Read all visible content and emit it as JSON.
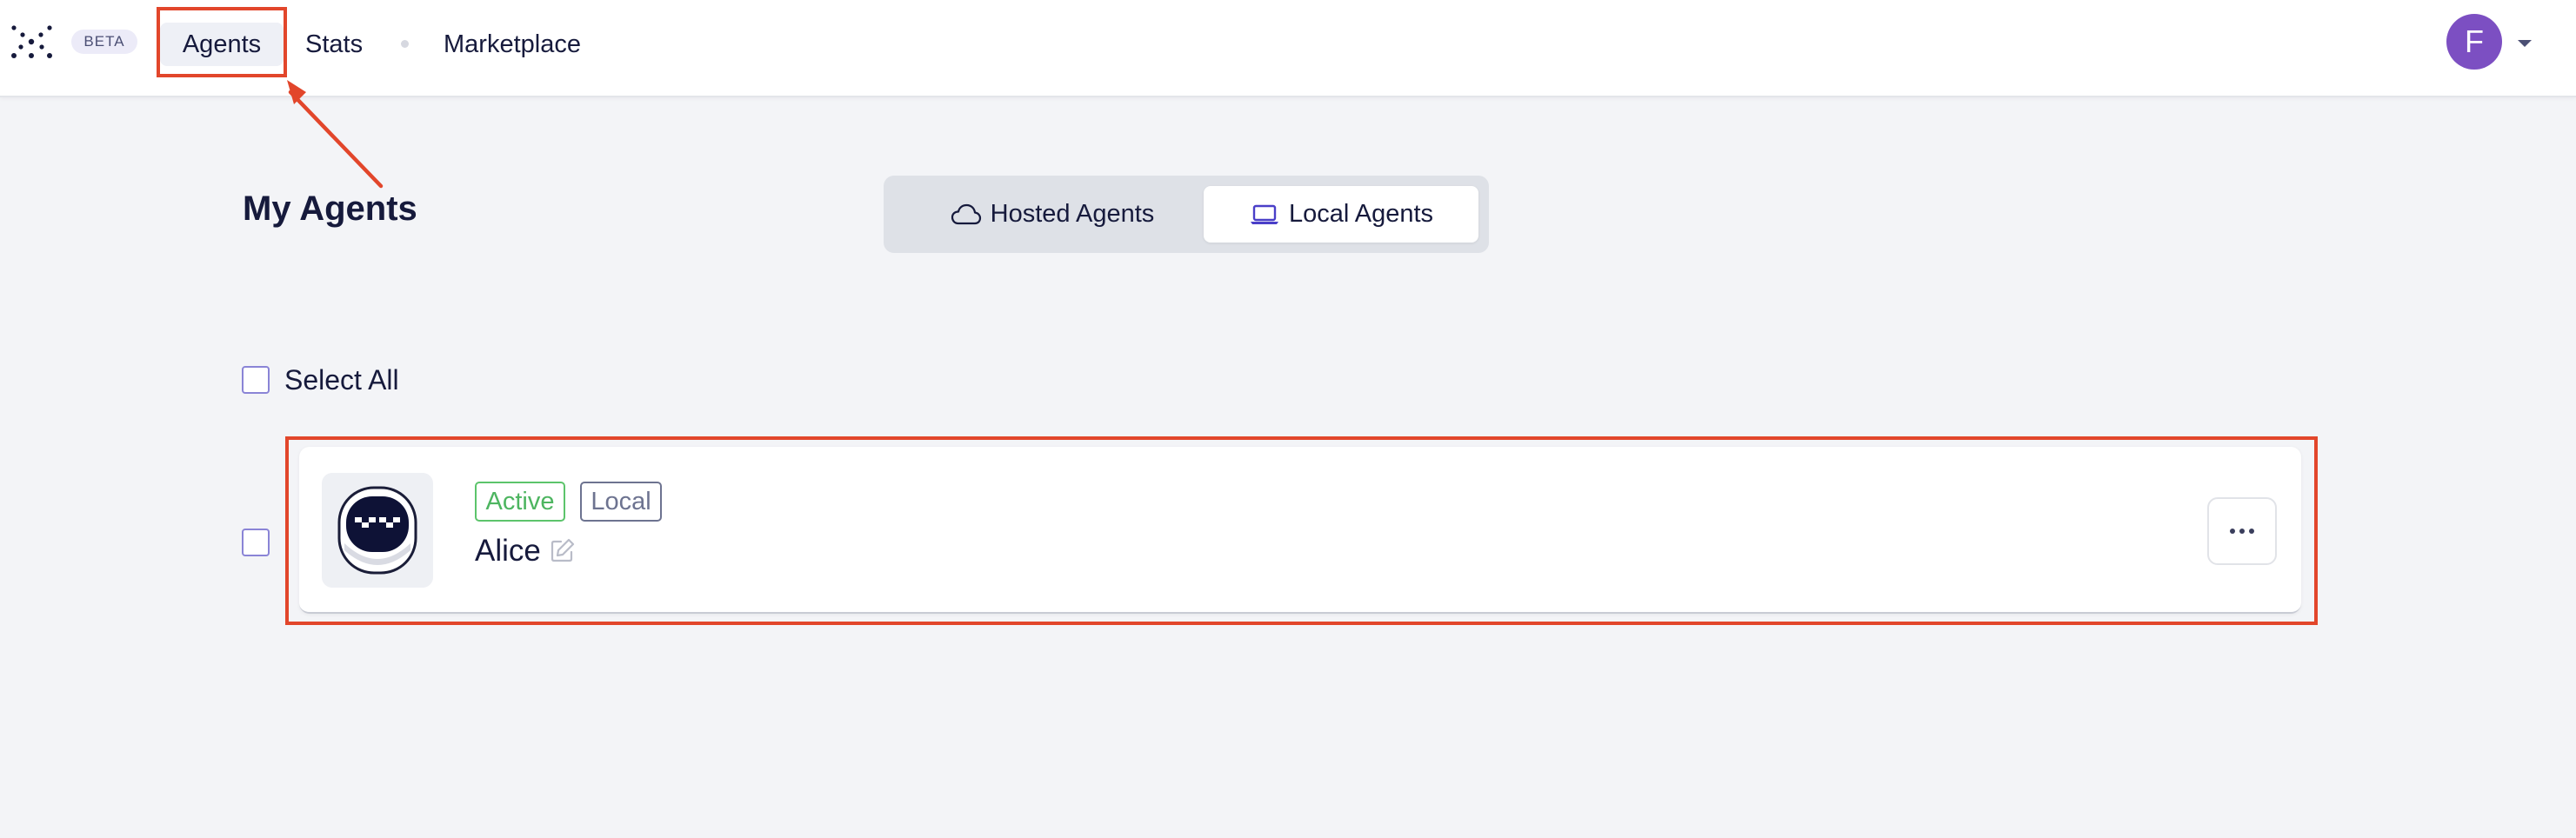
{
  "header": {
    "beta_label": "BETA",
    "nav": {
      "agents": "Agents",
      "stats": "Stats",
      "marketplace": "Marketplace"
    },
    "avatar_initial": "F"
  },
  "main": {
    "title": "My Agents",
    "toggle": {
      "hosted_label": "Hosted Agents",
      "local_label": "Local Agents",
      "selected": "Local Agents"
    },
    "select_all_label": "Select All",
    "agents": [
      {
        "name": "Alice",
        "status_badge": "Active",
        "type_badge": "Local"
      }
    ]
  },
  "colors": {
    "accent": "#7c4fc2",
    "active_green": "#4db560",
    "annotation_red": "#e2462b",
    "background": "#f3f4f7"
  },
  "icons": {
    "logo": "dots-logo-icon",
    "hosted": "cloud-icon",
    "local": "laptop-icon",
    "edit": "edit-pencil-icon",
    "more": "more-horizontal-icon",
    "caret": "caret-down-icon"
  }
}
